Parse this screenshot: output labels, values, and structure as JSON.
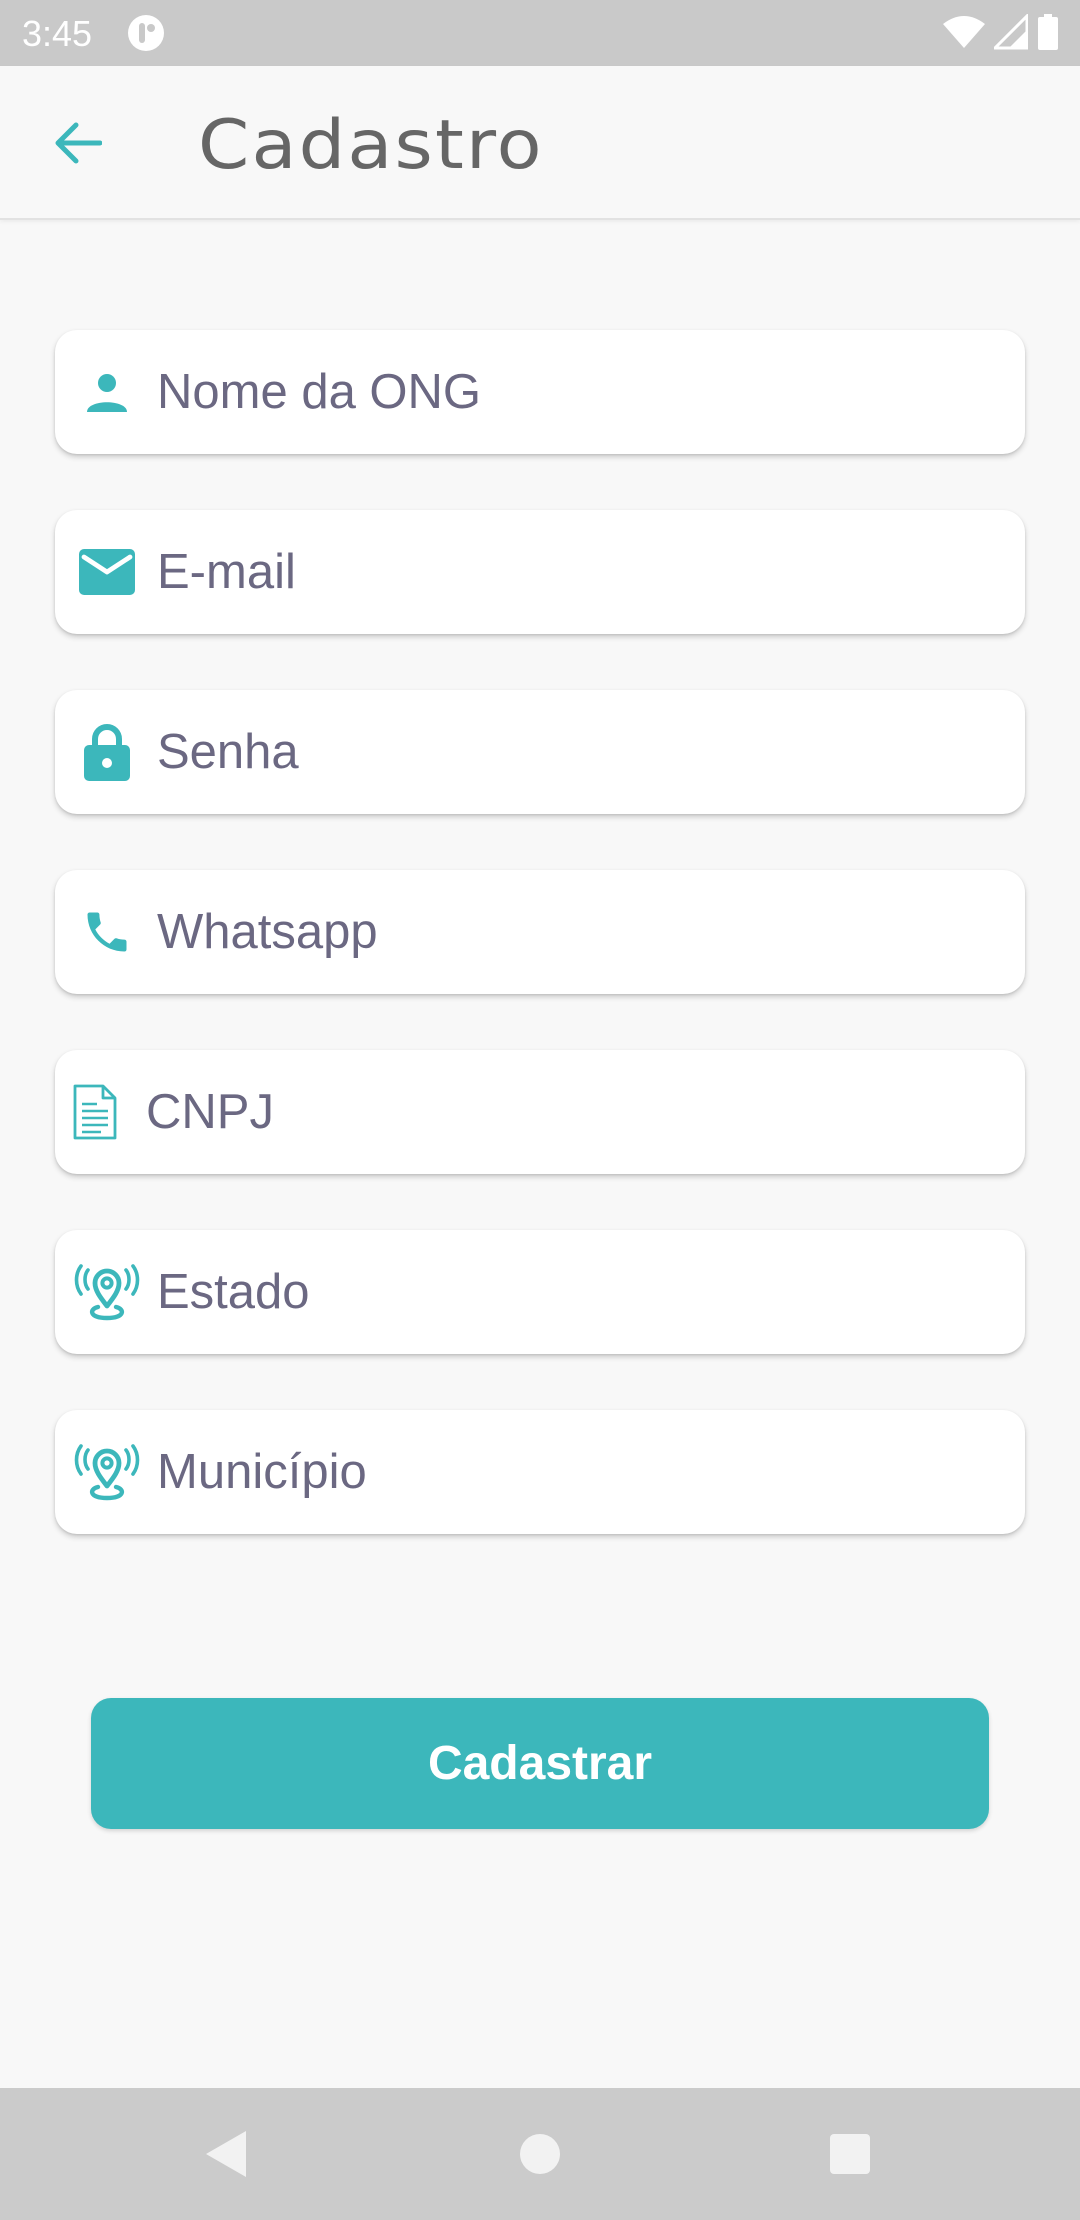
{
  "status_bar": {
    "time": "3:45"
  },
  "app_bar": {
    "title": "Cadastro",
    "back_icon": "arrow-left-icon"
  },
  "form": {
    "fields": [
      {
        "placeholder": "Nome da ONG",
        "icon": "person-icon"
      },
      {
        "placeholder": "E-mail",
        "icon": "mail-icon"
      },
      {
        "placeholder": "Senha",
        "icon": "lock-icon"
      },
      {
        "placeholder": "Whatsapp",
        "icon": "phone-icon"
      },
      {
        "placeholder": "CNPJ",
        "icon": "document-icon"
      },
      {
        "placeholder": "Estado",
        "icon": "location-pin-icon"
      },
      {
        "placeholder": "Município",
        "icon": "location-pin-icon"
      }
    ],
    "submit_label": "Cadastrar"
  },
  "colors": {
    "accent": "#3cb7bb",
    "text": "#6b6882",
    "title": "#666666",
    "background": "#f8f8f8"
  }
}
